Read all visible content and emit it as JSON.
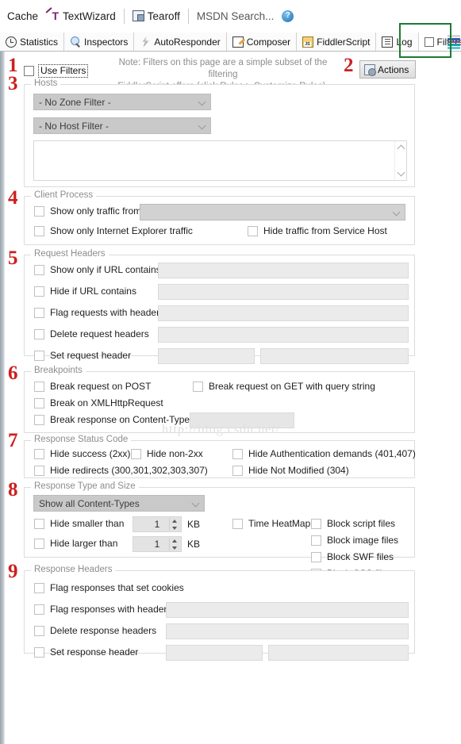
{
  "toolbar": {
    "items": [
      {
        "label": "Cache",
        "icon": null
      },
      {
        "label": "TextWizard",
        "icon": "textwizard-icon"
      },
      {
        "label": "Tearoff",
        "icon": "tearoff-icon"
      },
      {
        "label": "MSDN Search...",
        "icon": null
      },
      {
        "label": "",
        "icon": "help-icon"
      }
    ],
    "help_glyph": "?"
  },
  "tabs": [
    {
      "label": "Statistics",
      "icon": "stopwatch-icon",
      "active": false
    },
    {
      "label": "Inspectors",
      "icon": "magnifier-icon",
      "active": false
    },
    {
      "label": "AutoResponder",
      "icon": "lightning-bolt-icon",
      "active": false
    },
    {
      "label": "Composer",
      "icon": "pencil-note-icon",
      "active": false
    },
    {
      "label": "FiddlerScript",
      "icon": "js-script-icon",
      "active": false
    },
    {
      "label": "Log",
      "icon": "log-list-icon",
      "active": false
    },
    {
      "label": "Filters",
      "icon": "checkbox-icon",
      "active": true
    }
  ],
  "highlight_color": "#1d7a33",
  "right_bars_colors": [
    "#cfd8dc",
    "#2f5fa8",
    "#8e3b8e",
    "#16a5a5",
    "#59c6d8"
  ],
  "top_row": {
    "use_filters_label": "Use Filters",
    "note_line1": "Note: Filters on this page are a simple subset of the filtering",
    "note_line2": "FiddlerScript offers (click Rules > Customize Rules).",
    "actions_label": "Actions"
  },
  "step_numbers": [
    "1",
    "2",
    "3",
    "4",
    "5",
    "6",
    "7",
    "8",
    "9"
  ],
  "watermark": "http://blog.csdn.net/",
  "groups": {
    "hosts": {
      "legend": "Hosts",
      "zone_filter": "- No Zone Filter -",
      "host_filter": "- No Host Filter -",
      "hosts_text": ""
    },
    "client_process": {
      "legend": "Client Process",
      "show_only_traffic_from": "Show only traffic from",
      "process_value": "",
      "show_only_ie_traffic": "Show only Internet Explorer traffic",
      "hide_service_host": "Hide traffic from Service Host"
    },
    "request_headers": {
      "legend": "Request Headers",
      "rows": [
        {
          "label": "Show only if URL contains",
          "value": ""
        },
        {
          "label": "Hide if URL contains",
          "value": ""
        },
        {
          "label": "Flag requests with headers",
          "value": ""
        },
        {
          "label": "Delete request headers",
          "value": ""
        },
        {
          "label": "Set request header",
          "value": "",
          "value2": ""
        }
      ]
    },
    "breakpoints": {
      "legend": "Breakpoints",
      "break_post": "Break request on POST",
      "break_get_query": "Break request on GET with query string",
      "break_xhr": "Break on XMLHttpRequest",
      "break_response_ct": "Break response on Content-Type",
      "break_response_ct_value": ""
    },
    "response_status": {
      "legend": "Response Status Code",
      "hide_success": "Hide success (2xx)",
      "hide_non2xx": "Hide non-2xx",
      "hide_auth": "Hide Authentication demands (401,407)",
      "hide_redirects": "Hide redirects (300,301,302,303,307)",
      "hide_not_modified": "Hide Not Modified (304)"
    },
    "response_type_size": {
      "legend": "Response Type and Size",
      "content_types": "Show all Content-Types",
      "hide_smaller_than": "Hide smaller than",
      "hide_smaller_value": "1",
      "hide_larger_than": "Hide larger than",
      "hide_larger_value": "1",
      "kb_unit_1": "KB",
      "kb_unit_2": "KB",
      "time_heatmap": "Time HeatMap",
      "block_script": "Block script files",
      "block_image": "Block image files",
      "block_swf": "Block SWF files",
      "block_css": "Block CSS files"
    },
    "response_headers": {
      "legend": "Response Headers",
      "rows": [
        {
          "label": "Flag responses that set cookies",
          "value": null
        },
        {
          "label": "Flag responses with headers",
          "value": ""
        },
        {
          "label": "Delete response headers",
          "value": ""
        },
        {
          "label": "Set response header",
          "value": "",
          "value2": ""
        }
      ]
    }
  }
}
